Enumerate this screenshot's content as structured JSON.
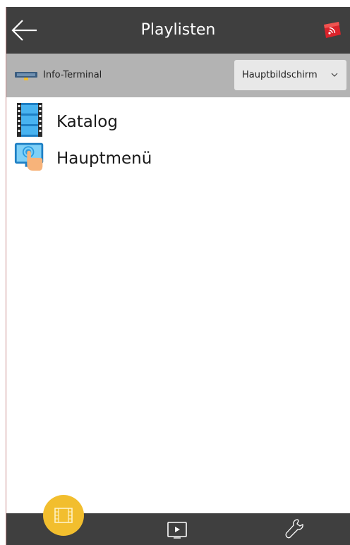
{
  "header": {
    "title": "Playlisten",
    "back_icon": "arrow-left-icon",
    "cast_icon": "screen-cast-icon"
  },
  "terminal": {
    "name": "Info-Terminal",
    "icon": "terminal-device-icon",
    "screen_select": {
      "value": "Hauptbildschirm"
    }
  },
  "playlists": [
    {
      "label": "Katalog",
      "icon": "film-strip-icon"
    },
    {
      "label": "Hauptmenü",
      "icon": "touch-screen-icon"
    }
  ],
  "bottom_nav": {
    "items": [
      {
        "name": "playlists",
        "icon": "film-strip-icon",
        "active": true
      },
      {
        "name": "player",
        "icon": "play-screen-icon",
        "active": false
      },
      {
        "name": "tools",
        "icon": "wrench-icon",
        "active": false
      }
    ]
  },
  "colors": {
    "header_bg": "#3f3f3f",
    "terminal_bar_bg": "#b3b3b3",
    "accent": "#f2be2e",
    "film_blue": "#2a9be0"
  }
}
